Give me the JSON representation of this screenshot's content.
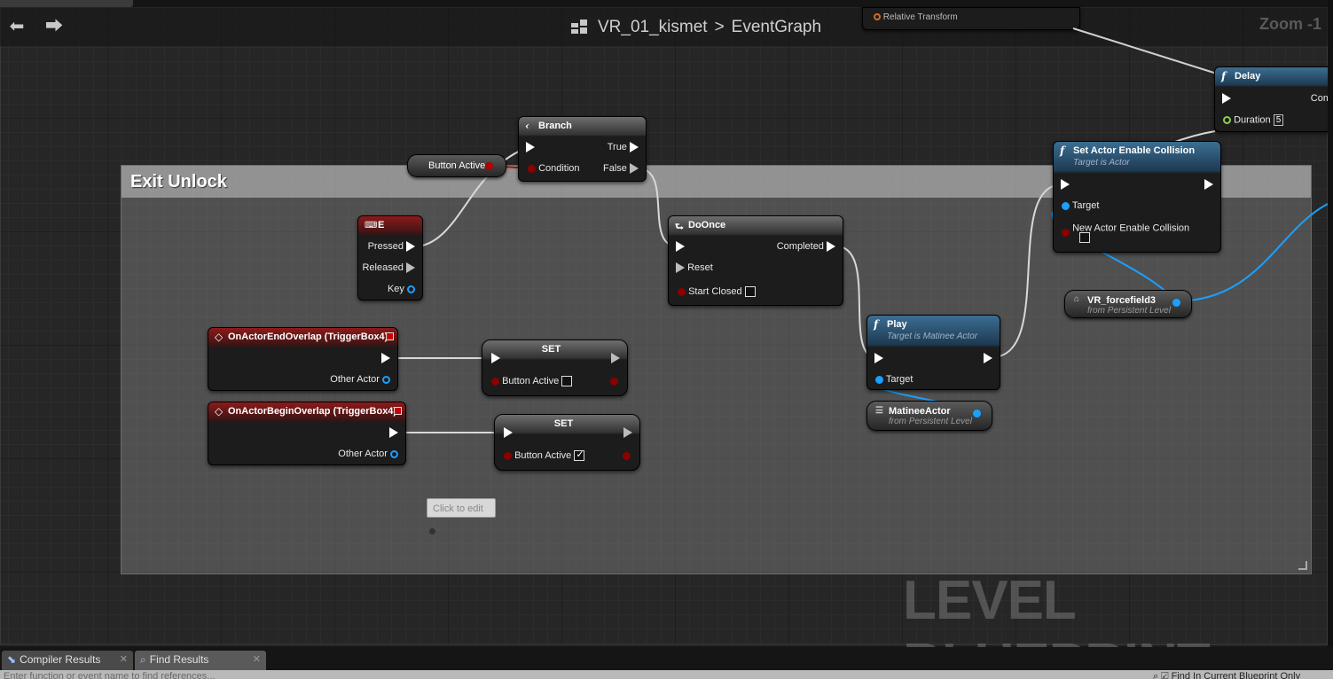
{
  "titlebar": {
    "blueprint_name": "VR_01_kismet",
    "separator": ">",
    "graph_name": "EventGraph",
    "zoom": "Zoom -1"
  },
  "comment": {
    "title": "Exit Unlock"
  },
  "nodes": {
    "branch": {
      "title": "Branch",
      "true_label": "True",
      "false_label": "False",
      "condition_label": "Condition"
    },
    "button_active_getter": {
      "label": "Button Active"
    },
    "key_e": {
      "title": "E",
      "pressed": "Pressed",
      "released": "Released",
      "key": "Key"
    },
    "doonce": {
      "title": "DoOnce",
      "completed": "Completed",
      "reset": "Reset",
      "start_closed": "Start Closed"
    },
    "end_overlap": {
      "title": "OnActorEndOverlap (TriggerBox4)",
      "other_actor": "Other Actor"
    },
    "begin_overlap": {
      "title": "OnActorBeginOverlap (TriggerBox4)",
      "other_actor": "Other Actor"
    },
    "set1": {
      "title": "SET",
      "var": "Button Active",
      "checked": false
    },
    "set2": {
      "title": "SET",
      "var": "Button Active",
      "checked": true
    },
    "play": {
      "title": "Play",
      "subtitle": "Target is Matinee Actor",
      "target": "Target"
    },
    "matinee_actor": {
      "label": "MatineeActor",
      "sub": "from Persistent Level"
    },
    "set_collision": {
      "title": "Set Actor Enable Collision",
      "subtitle": "Target is Actor",
      "target": "Target",
      "new_collision": "New Actor Enable Collision"
    },
    "forcefield": {
      "label": "VR_forcefield3",
      "sub": "from Persistent Level"
    },
    "delay": {
      "title": "Delay",
      "completed": "Com",
      "duration": "Duration",
      "duration_value": "5"
    },
    "relative_transform": {
      "label": "Relative Transform"
    }
  },
  "click_to_edit": "Click to edit",
  "watermark": "LEVEL BLUEPRINT",
  "bottom_tabs": [
    {
      "label": "Compiler Results",
      "icon": "compiler-icon"
    },
    {
      "label": "Find Results",
      "icon": "search-icon"
    }
  ],
  "search": {
    "placeholder": "Enter function or event name to find references...",
    "checkbox_label": "Find In Current Blueprint Only"
  },
  "colors": {
    "event_header": "#8c1a1a",
    "function_header": "#3b6e92",
    "object_pin": "#1aa0ff",
    "bool_pin": "#8b0000",
    "float_pin": "#8ed14b"
  }
}
